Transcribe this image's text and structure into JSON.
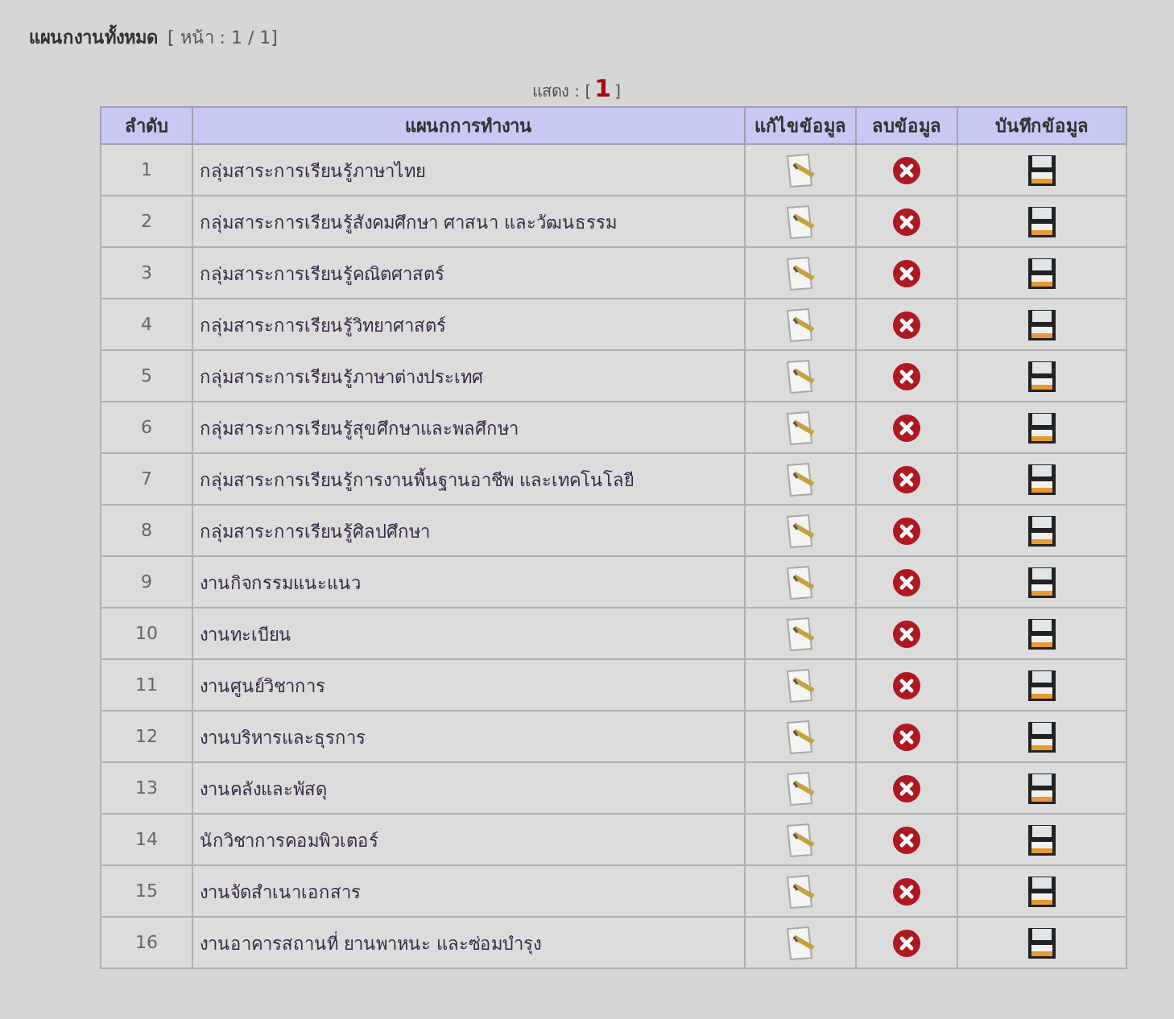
{
  "heading": {
    "title": "แผนกงานทั้งหมด",
    "page_info": "[ หน้า : 1 / 1]"
  },
  "pager": {
    "label": "แสดง : [",
    "current": "1",
    "close": "]"
  },
  "table": {
    "columns": [
      "ลำดับ",
      "แผนกการทำงาน",
      "แก้ไขข้อมูล",
      "ลบข้อมูล",
      "บันทึกข้อมูล"
    ],
    "rows": [
      {
        "no": "1",
        "name": "กลุ่มสาระการเรียนรู้ภาษาไทย"
      },
      {
        "no": "2",
        "name": "กลุ่มสาระการเรียนรู้สังคมศึกษา ศาสนา และวัฒนธรรม"
      },
      {
        "no": "3",
        "name": "กลุ่มสาระการเรียนรู้คณิตศาสตร์"
      },
      {
        "no": "4",
        "name": "กลุ่มสาระการเรียนรู้วิทยาศาสตร์"
      },
      {
        "no": "5",
        "name": "กลุ่มสาระการเรียนรู้ภาษาต่างประเทศ"
      },
      {
        "no": "6",
        "name": "กลุ่มสาระการเรียนรู้สุขศึกษาและพลศึกษา"
      },
      {
        "no": "7",
        "name": "กลุ่มสาระการเรียนรู้การงานพื้นฐานอาชีพ และเทคโนโลยี"
      },
      {
        "no": "8",
        "name": "กลุ่มสาระการเรียนรู้ศิลปศึกษา"
      },
      {
        "no": "9",
        "name": "งานกิจกรรมแนะแนว"
      },
      {
        "no": "10",
        "name": "งานทะเบียน"
      },
      {
        "no": "11",
        "name": "งานศูนย์วิชาการ"
      },
      {
        "no": "12",
        "name": "งานบริหารและธุรการ"
      },
      {
        "no": "13",
        "name": "งานคลังและพัสดุ"
      },
      {
        "no": "14",
        "name": "นักวิชาการคอมพิวเตอร์"
      },
      {
        "no": "15",
        "name": "งานจัดสำเนาเอกสาร"
      },
      {
        "no": "16",
        "name": "งานอาคารสถานที่ ยานพาหนะ และซ่อมบำรุง"
      }
    ]
  }
}
